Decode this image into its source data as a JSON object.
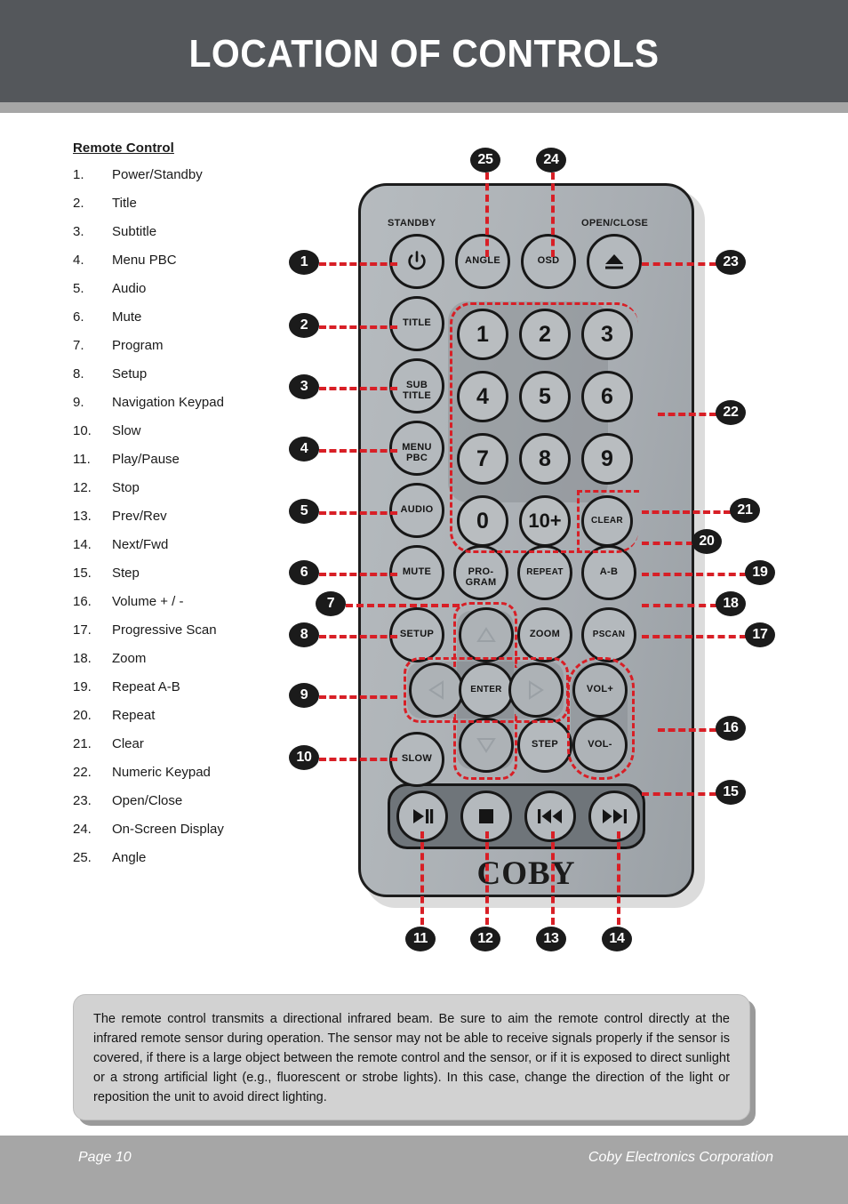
{
  "header": {
    "title": "LOCATION OF CONTROLS"
  },
  "list": {
    "title": "Remote Control",
    "items": [
      {
        "num": "1.",
        "label": "Power/Standby"
      },
      {
        "num": "2.",
        "label": "Title"
      },
      {
        "num": "3.",
        "label": "Subtitle"
      },
      {
        "num": "4.",
        "label": "Menu PBC"
      },
      {
        "num": "5.",
        "label": "Audio"
      },
      {
        "num": "6.",
        "label": "Mute"
      },
      {
        "num": "7.",
        "label": "Program"
      },
      {
        "num": "8.",
        "label": "Setup"
      },
      {
        "num": "9.",
        "label": "Navigation Keypad"
      },
      {
        "num": "10.",
        "label": "Slow"
      },
      {
        "num": "11.",
        "label": "Play/Pause"
      },
      {
        "num": "12.",
        "label": "Stop"
      },
      {
        "num": "13.",
        "label": "Prev/Rev"
      },
      {
        "num": "14.",
        "label": "Next/Fwd"
      },
      {
        "num": "15.",
        "label": "Step"
      },
      {
        "num": "16.",
        "label": "Volume + / -"
      },
      {
        "num": "17.",
        "label": "Progressive Scan"
      },
      {
        "num": "18.",
        "label": "Zoom"
      },
      {
        "num": "19.",
        "label": "Repeat A-B"
      },
      {
        "num": "20.",
        "label": "Repeat"
      },
      {
        "num": "21.",
        "label": "Clear"
      },
      {
        "num": "22.",
        "label": "Numeric Keypad"
      },
      {
        "num": "23.",
        "label": "Open/Close"
      },
      {
        "num": "24.",
        "label": "On-Screen Display"
      },
      {
        "num": "25.",
        "label": "Angle"
      }
    ]
  },
  "remote": {
    "section_labels": {
      "standby": "STANDBY",
      "open_close": "OPEN/CLOSE"
    },
    "brand": "COBY",
    "keys": {
      "power": "",
      "angle": "ANGLE",
      "osd": "OSD",
      "eject": "",
      "title": "TITLE",
      "subtitle_l1": "SUB",
      "subtitle_l2": "TITLE",
      "menu_l1": "MENU",
      "menu_l2": "PBC",
      "audio": "AUDIO",
      "mute": "MUTE",
      "setup": "SETUP",
      "slow": "SLOW",
      "n1": "1",
      "n2": "2",
      "n3": "3",
      "n4": "4",
      "n5": "5",
      "n6": "6",
      "n7": "7",
      "n8": "8",
      "n9": "9",
      "n0": "0",
      "n10plus": "10+",
      "clear": "CLEAR",
      "program_l1": "PRO-",
      "program_l2": "GRAM",
      "repeat": "REPEAT",
      "ab": "A-B",
      "zoom": "ZOOM",
      "pscan": "PSCAN",
      "enter": "ENTER",
      "volup": "VOL+",
      "voldown": "VOL-",
      "step": "STEP",
      "up": "",
      "down": "",
      "left": "",
      "right": "",
      "play_pause": "",
      "stop": "",
      "prev": "",
      "next": ""
    }
  },
  "callouts": {
    "c1": "1",
    "c2": "2",
    "c3": "3",
    "c4": "4",
    "c5": "5",
    "c6": "6",
    "c7": "7",
    "c8": "8",
    "c9": "9",
    "c10": "10",
    "c11": "11",
    "c12": "12",
    "c13": "13",
    "c14": "14",
    "c15": "15",
    "c16": "16",
    "c17": "17",
    "c18": "18",
    "c19": "19",
    "c20": "20",
    "c21": "21",
    "c22": "22",
    "c23": "23",
    "c24": "24",
    "c25": "25"
  },
  "note": {
    "text": "The remote control transmits a directional infrared beam. Be sure to aim the remote control directly at the infrared remote sensor during operation. The sensor may not be able to receive signals properly if the sensor is covered, if there is a large object between the remote control and the sensor, or if it is exposed to direct sunlight or a strong artificial light (e.g., fluorescent or strobe lights). In this case, change the direction of the light or reposition the unit to avoid direct lighting."
  },
  "footer": {
    "page": "Page 10",
    "company": "Coby Electronics Corporation"
  },
  "colors": {
    "header_bg": "#54575b",
    "band": "#a6a6a6",
    "accent_red": "#d81f26",
    "callout_bg": "#1b1b1b"
  }
}
